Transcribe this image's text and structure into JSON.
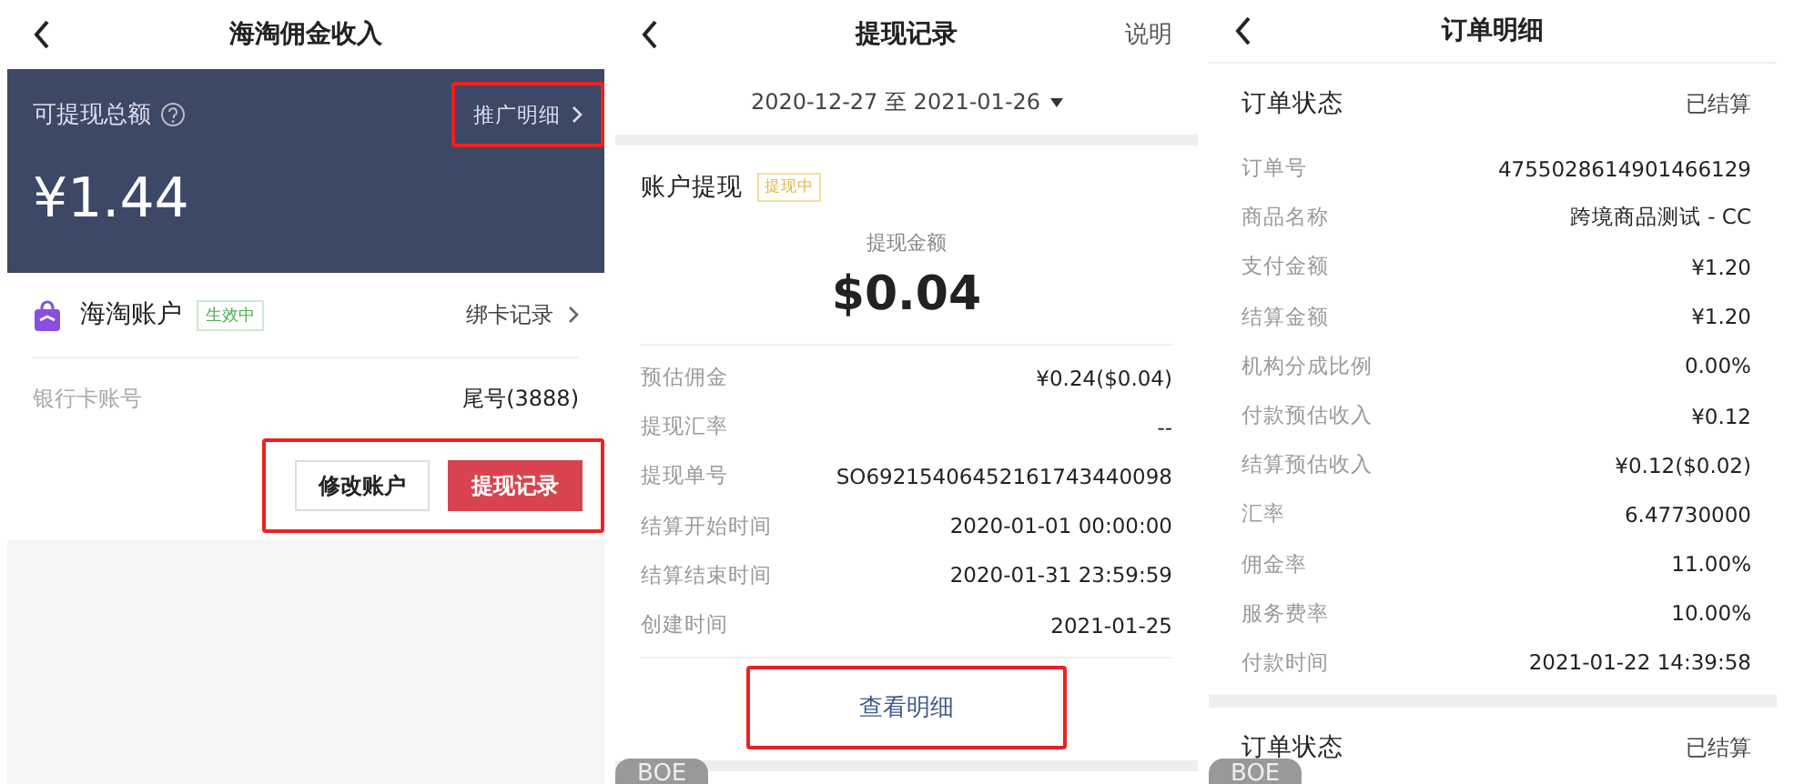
{
  "income_screen": {
    "title": "海淘佣金收入",
    "balance": {
      "label": "可提现总额",
      "amount": "¥1.44",
      "link": {
        "label": "推广明细",
        "highlighted": true
      }
    },
    "account": {
      "name": "海淘账户",
      "badge": "生效中",
      "link": "绑卡记录"
    },
    "bank": {
      "label": "银行卡账号",
      "value": "尾号(3888)"
    },
    "actions": {
      "highlighted": true,
      "buttons": [
        {
          "label": "修改账户",
          "kind": "secondary"
        },
        {
          "label": "提现记录",
          "kind": "primary"
        }
      ]
    }
  },
  "withdraw_screen": {
    "title": "提现记录",
    "header_action": "说明",
    "date_range": "2020-12-27 至 2021-01-26",
    "record": {
      "title": "账户提现",
      "badge": "提现中",
      "amount_label": "提现金额",
      "amount": "$0.04",
      "rows": [
        {
          "label": "预估佣金",
          "value": "¥0.24($0.04)"
        },
        {
          "label": "提现汇率",
          "value": "--"
        },
        {
          "label": "提现单号",
          "value": "SO69215406452161743440098"
        },
        {
          "label": "结算开始时间",
          "value": "2020-01-01 00:00:00"
        },
        {
          "label": "结算结束时间",
          "value": "2020-01-31 23:59:59"
        },
        {
          "label": "创建时间",
          "value": "2021-01-25"
        }
      ]
    },
    "view_details": {
      "label": "查看明细",
      "highlighted": true
    },
    "env_tag": "BOE"
  },
  "order_screen": {
    "title": "订单明细",
    "sections": [
      {
        "status_label": "订单状态",
        "status": "已结算",
        "rows": [
          {
            "label": "订单号",
            "value": "4755028614901466129"
          },
          {
            "label": "商品名称",
            "value": "跨境商品测试 - CC"
          },
          {
            "label": "支付金额",
            "value": "¥1.20"
          },
          {
            "label": "结算金额",
            "value": "¥1.20"
          },
          {
            "label": "机构分成比例",
            "value": "0.00%"
          },
          {
            "label": "付款预估收入",
            "value": "¥0.12"
          },
          {
            "label": "结算预估收入",
            "value": "¥0.12($0.02)"
          },
          {
            "label": "汇率",
            "value": "6.47730000"
          },
          {
            "label": "佣金率",
            "value": "11.00%"
          },
          {
            "label": "服务费率",
            "value": "10.00%"
          },
          {
            "label": "付款时间",
            "value": "2021-01-22 14:39:58"
          }
        ]
      },
      {
        "status_label": "订单状态",
        "status": "已结算"
      }
    ],
    "env_tag": "BOE"
  }
}
